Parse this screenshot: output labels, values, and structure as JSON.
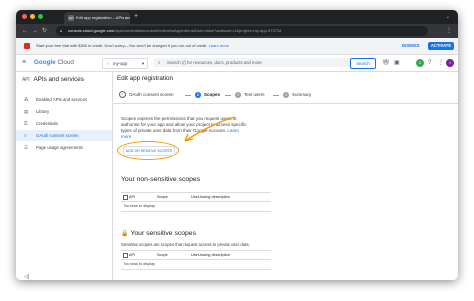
{
  "browser": {
    "tab_title": "Edit app registration – APIs an...",
    "tab_favicon": "API",
    "tab_close": "×",
    "new_tab": "+",
    "url_host": "console.cloud.google.com",
    "url_path": "/apis/credentials/consent/edit;newAppInternalUser=false?authuser=1&project=my-app-573718",
    "traffic_colors": [
      "#ff5f57",
      "#febc2e",
      "#28c840"
    ]
  },
  "banner": {
    "text": "Start your free trial with $300 in credit. Don't worry—You won't be charged if you run out of credit. ",
    "link": "Learn more",
    "dismiss": "DISMISS",
    "activate": "ACTIVATE"
  },
  "header": {
    "logo_g": "Google",
    "logo_text": " Cloud",
    "project": "my-app",
    "search_placeholder": "Search (/) for resources, docs, products and more",
    "search_button": "Search",
    "notif_count": "1",
    "avatar_letter": "t"
  },
  "sidebar": {
    "title_icon": "API",
    "title": "APIs and services",
    "items": [
      {
        "label": "Enabled APIs and services",
        "icon": "grid-icon"
      },
      {
        "label": "Library",
        "icon": "library-icon"
      },
      {
        "label": "Credentials",
        "icon": "key-icon"
      },
      {
        "label": "OAuth consent screen",
        "icon": "consent-icon"
      },
      {
        "label": "Page usage agreements",
        "icon": "settings-list-icon"
      }
    ],
    "active_index": 3,
    "collapse_glyph": "◁|"
  },
  "main": {
    "title": "Edit app registration",
    "steps": [
      {
        "num": "✓",
        "label": "OAuth consent screen"
      },
      {
        "num": "2",
        "label": "Scopes"
      },
      {
        "num": "3",
        "label": "Test users"
      },
      {
        "num": "4",
        "label": "Summary"
      }
    ],
    "description": "Scopes express the permissions that you request users to authorise for your app and allow your project to access specific types of private user data from their Google Account. ",
    "description_link": "Learn more",
    "add_button": "ADD OR REMOVE SCOPES",
    "highlight_color": "#f29900",
    "non_sensitive": {
      "title": "Your non-sensitive scopes",
      "columns": [
        "API",
        "Scope",
        "User-facing description"
      ],
      "empty": "No rows to display"
    },
    "sensitive": {
      "lock_glyph": "🔒",
      "title": "Your sensitive scopes",
      "description": "Sensitive scopes are scopes that request access to private user data.",
      "columns": [
        "API",
        "Scope",
        "User-facing description"
      ],
      "empty": "No rows to display"
    }
  }
}
